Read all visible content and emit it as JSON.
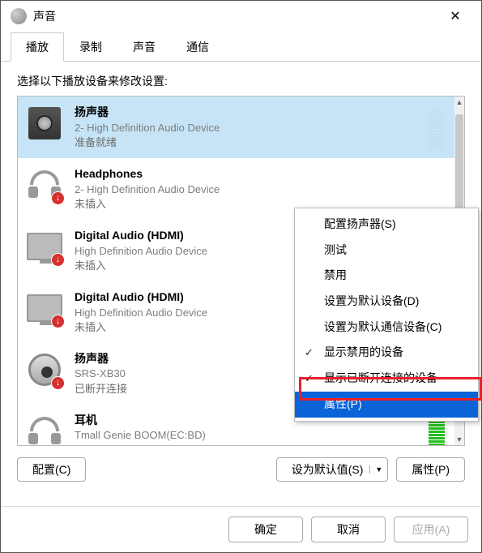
{
  "title": "声音",
  "tabs": [
    "播放",
    "录制",
    "声音",
    "通信"
  ],
  "activeTab": 0,
  "heading": "选择以下播放设备来修改设置:",
  "devices": [
    {
      "name": "扬声器",
      "sub": "2- High Definition Audio Device",
      "status": "准备就绪",
      "icon": "speaker",
      "selected": true,
      "vu": "blue",
      "badge": null
    },
    {
      "name": "Headphones",
      "sub": "2- High Definition Audio Device",
      "status": "未插入",
      "icon": "headphones",
      "selected": false,
      "vu": null,
      "badge": "down"
    },
    {
      "name": "Digital Audio (HDMI)",
      "sub": "High Definition Audio Device",
      "status": "未插入",
      "icon": "monitor",
      "selected": false,
      "vu": null,
      "badge": "down"
    },
    {
      "name": "Digital Audio (HDMI)",
      "sub": "High Definition Audio Device",
      "status": "未插入",
      "icon": "monitor",
      "selected": false,
      "vu": null,
      "badge": "down"
    },
    {
      "name": "扬声器",
      "sub": "SRS-XB30",
      "status": "已断开连接",
      "icon": "jack",
      "selected": false,
      "vu": null,
      "badge": "down"
    },
    {
      "name": "耳机",
      "sub": "Tmall Genie BOOM(EC:BD)",
      "status": "",
      "icon": "headphones",
      "selected": false,
      "vu": "green",
      "badge": null
    }
  ],
  "buttons": {
    "configure": "配置(C)",
    "setDefault": "设为默认值(S)",
    "properties": "属性(P)"
  },
  "footer": {
    "ok": "确定",
    "cancel": "取消",
    "apply": "应用(A)"
  },
  "contextMenu": {
    "items": [
      {
        "label": "配置扬声器(S)",
        "checked": false
      },
      {
        "label": "测试",
        "checked": false
      },
      {
        "label": "禁用",
        "checked": false
      },
      {
        "label": "设置为默认设备(D)",
        "checked": false
      },
      {
        "label": "设置为默认通信设备(C)",
        "checked": false
      },
      {
        "label": "显示禁用的设备",
        "checked": true
      },
      {
        "label": "显示已断开连接的设备",
        "checked": true
      },
      {
        "label": "属性(P)",
        "checked": false,
        "highlight": true
      }
    ]
  }
}
